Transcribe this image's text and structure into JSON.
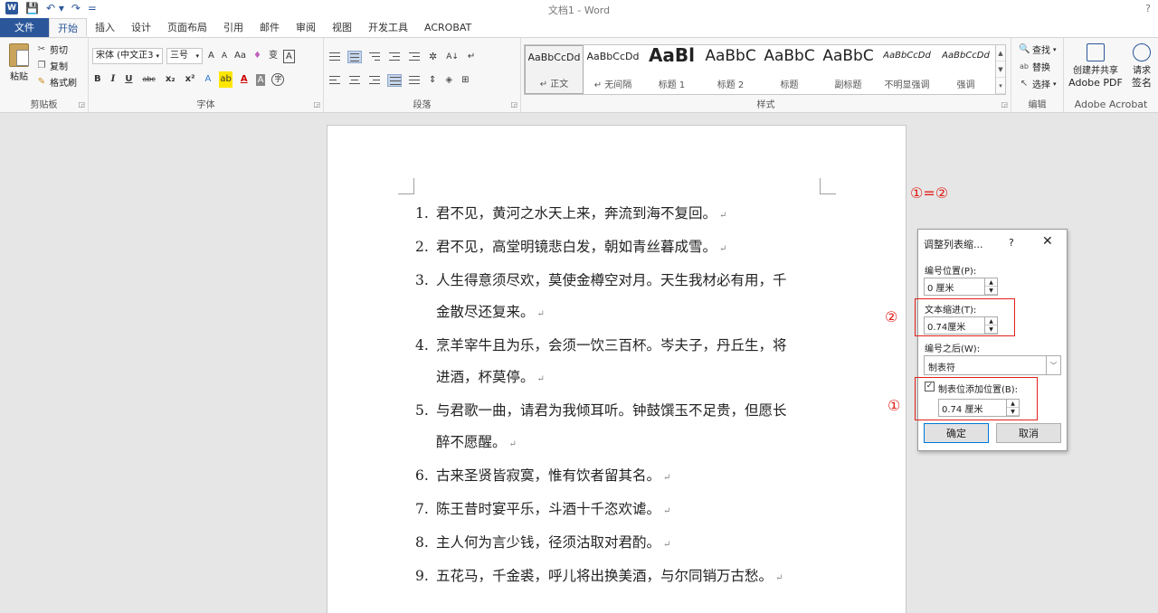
{
  "window": {
    "title": "文档1 - Word",
    "help": "?",
    "quick_access": [
      "W",
      "💾",
      "↶ ▾",
      "↷",
      "="
    ]
  },
  "tabs": [
    {
      "label": "文件",
      "kind": "file"
    },
    {
      "label": "开始",
      "kind": "active"
    },
    {
      "label": "插入"
    },
    {
      "label": "设计"
    },
    {
      "label": "页面布局"
    },
    {
      "label": "引用"
    },
    {
      "label": "邮件"
    },
    {
      "label": "审阅"
    },
    {
      "label": "视图"
    },
    {
      "label": "开发工具"
    },
    {
      "label": "ACROBAT"
    }
  ],
  "ribbon": {
    "clipboard": {
      "paste": "粘贴",
      "cut": "剪切",
      "copy": "复制",
      "format_painter": "格式刷",
      "group": "剪贴板"
    },
    "font": {
      "font_name": "宋体 (中文正3",
      "font_size": "三号",
      "grow": "A",
      "shrink": "A",
      "case": "Aa",
      "clear": "♦",
      "phonetic": "变",
      "border_a": "A",
      "bold": "B",
      "italic": "I",
      "underline": "U",
      "strike": "abc",
      "sub": "x₂",
      "sup": "x²",
      "effects": "A",
      "highlight": "ab",
      "color": "A",
      "shade": "A",
      "enclose": "字",
      "group": "字体"
    },
    "paragraph": {
      "group": "段落"
    },
    "styles": {
      "items": [
        {
          "sample": "AaBbCcDd",
          "name": "↵ 正文",
          "size": "small",
          "selected": true
        },
        {
          "sample": "AaBbCcDd",
          "name": "↵ 无间隔",
          "size": "small"
        },
        {
          "sample": "AaBl",
          "name": "标题 1",
          "size": "big"
        },
        {
          "sample": "AaBbC",
          "name": "标题 2",
          "size": "med"
        },
        {
          "sample": "AaBbC",
          "name": "标题",
          "size": "med"
        },
        {
          "sample": "AaBbC",
          "name": "副标题",
          "size": "med"
        },
        {
          "sample": "AaBbCcDd",
          "name": "不明显强调",
          "size": "ital"
        },
        {
          "sample": "AaBbCcDd",
          "name": "强调",
          "size": "ital"
        }
      ],
      "group": "样式"
    },
    "editing": {
      "find": "查找",
      "replace": "替换",
      "select": "选择",
      "group": "编辑"
    },
    "acrobat": {
      "create_line1": "创建并共享",
      "create_line2": "Adobe PDF",
      "request_line1": "请求",
      "request_line2": "签名",
      "group": "Adobe Acrobat"
    }
  },
  "document": {
    "list": [
      {
        "num": "1.",
        "lines": [
          "君不见，黄河之水天上来，奔流到海不复回。"
        ]
      },
      {
        "num": "2.",
        "lines": [
          "君不见，高堂明镜悲白发，朝如青丝暮成雪。"
        ]
      },
      {
        "num": "3.",
        "lines": [
          "人生得意须尽欢，莫使金樽空对月。天生我材必有用，千",
          "金散尽还复来。"
        ]
      },
      {
        "num": "4.",
        "lines": [
          "烹羊宰牛且为乐，会须一饮三百杯。岑夫子，丹丘生，将",
          "进酒，杯莫停。"
        ]
      },
      {
        "num": "5.",
        "lines": [
          "与君歌一曲，请君为我倾耳听。钟鼓馔玉不足贵，但愿长",
          "醉不愿醒。"
        ]
      },
      {
        "num": "6.",
        "lines": [
          "古来圣贤皆寂寞，惟有饮者留其名。"
        ]
      },
      {
        "num": "7.",
        "lines": [
          "陈王昔时宴平乐，斗酒十千恣欢谑。"
        ]
      },
      {
        "num": "8.",
        "lines": [
          "主人何为言少钱，径须沽取对君酌。"
        ]
      },
      {
        "num": "9.",
        "lines": [
          "五花马，千金裘，呼儿将出换美酒，与尔同销万古愁。"
        ]
      }
    ],
    "para_mark": "↵"
  },
  "annotations": {
    "equation": "①=②",
    "two": "②",
    "one": "①"
  },
  "dialog": {
    "title": "调整列表缩...",
    "help": "?",
    "close": "✕",
    "number_pos_label": "编号位置(P):",
    "number_pos_value": "0 厘米",
    "text_indent_label": "文本缩进(T):",
    "text_indent_value": "0.74厘米",
    "follow_label": "编号之后(W):",
    "follow_value": "制表符",
    "tab_check_label": "制表位添加位置(B):",
    "tab_check_checked": "✓",
    "tab_value": "0.74 厘米",
    "ok": "确定",
    "cancel": "取消"
  }
}
